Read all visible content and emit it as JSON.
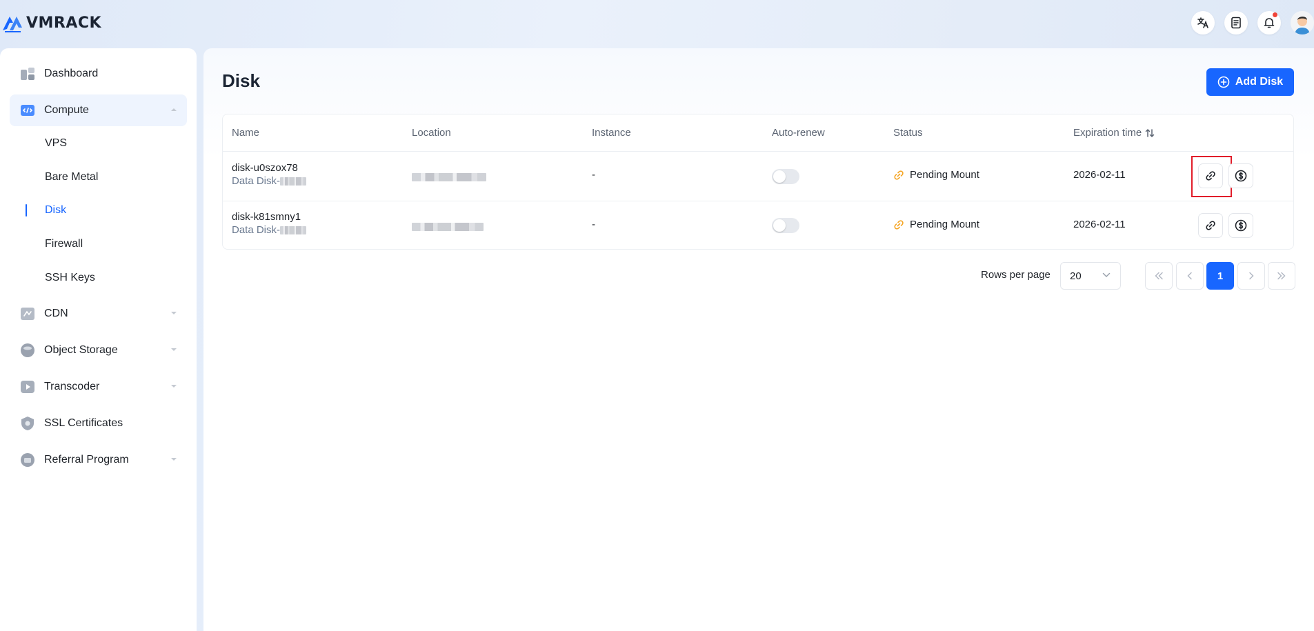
{
  "brand": {
    "name": "VMRACK"
  },
  "header": {
    "icons": [
      "translate-icon",
      "document-icon",
      "bell-icon",
      "avatar"
    ]
  },
  "sidebar": {
    "items": [
      {
        "label": "Dashboard"
      },
      {
        "label": "Compute",
        "expanded": true,
        "children": [
          {
            "label": "VPS"
          },
          {
            "label": "Bare Metal"
          },
          {
            "label": "Disk",
            "active": true
          },
          {
            "label": "Firewall"
          },
          {
            "label": "SSH Keys"
          }
        ]
      },
      {
        "label": "CDN"
      },
      {
        "label": "Object Storage"
      },
      {
        "label": "Transcoder"
      },
      {
        "label": "SSL Certificates"
      },
      {
        "label": "Referral Program"
      }
    ]
  },
  "page": {
    "title": "Disk",
    "add_button": "Add Disk"
  },
  "table": {
    "columns": [
      "Name",
      "Location",
      "Instance",
      "Auto-renew",
      "Status",
      "Expiration time"
    ],
    "rows": [
      {
        "name": "disk-u0szox78",
        "type": "Data Disk-",
        "instance": "-",
        "auto_renew": false,
        "status": "Pending Mount",
        "expiration": "2026-02-11"
      },
      {
        "name": "disk-k81smny1",
        "type": "Data Disk-",
        "instance": "-",
        "auto_renew": false,
        "status": "Pending Mount",
        "expiration": "2026-02-11"
      }
    ]
  },
  "pagination": {
    "rows_per_page_label": "Rows per page",
    "rows_per_page": "20",
    "current_page": "1"
  },
  "colors": {
    "accent": "#1866ff",
    "status_pending": "#f5a524",
    "highlight": "#e11d2a"
  }
}
